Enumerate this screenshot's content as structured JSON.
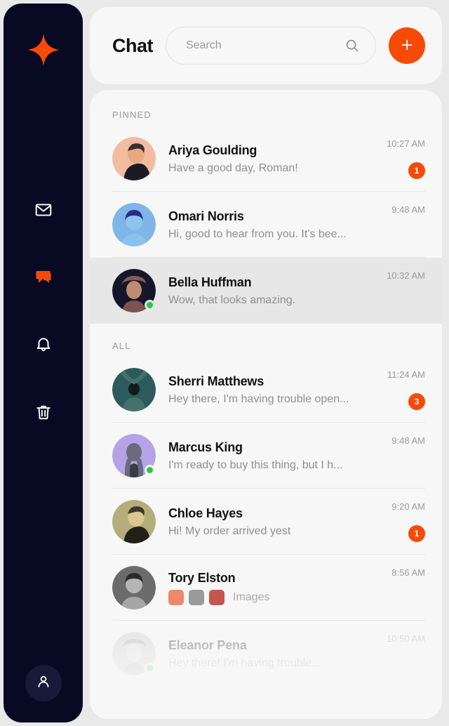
{
  "colors": {
    "accent": "#F74A07",
    "sidebar_bg": "#080A24",
    "card_bg": "#f7f7f7",
    "selected_bg": "#e7e7e7",
    "online": "#27C940",
    "page_bg": "#e9e9e9"
  },
  "sidebar": {
    "logo": "sparkle-logo",
    "items": [
      {
        "icon": "mail-icon",
        "name": "mail",
        "active": false
      },
      {
        "icon": "chat-icon",
        "name": "chat",
        "active": true
      },
      {
        "icon": "bell-icon",
        "name": "notifications",
        "active": false
      },
      {
        "icon": "trash-icon",
        "name": "trash",
        "active": false
      }
    ],
    "profile": {
      "icon": "user-icon",
      "name": "profile"
    }
  },
  "header": {
    "title": "Chat",
    "search": {
      "placeholder": "Search",
      "value": "",
      "icon": "search-icon"
    },
    "add_button": {
      "icon": "plus-icon",
      "label": "+"
    }
  },
  "list": {
    "sections": [
      {
        "label": "PINNED",
        "rows": [
          {
            "name": "Ariya Goulding",
            "preview": "Have a good day, Roman!",
            "time": "10:27 AM",
            "badge": "1",
            "online": false,
            "selected": false,
            "avatar": {
              "bg": "#F3BCA0",
              "fig": "#1b1b24",
              "skin": "#e8a882"
            }
          },
          {
            "name": "Omari Norris",
            "preview": "Hi, good to hear from you. It's bee...",
            "time": "9:48 AM",
            "badge": "",
            "online": false,
            "selected": false,
            "avatar": {
              "bg": "#7FB5E8",
              "fig": "#2C2C8C",
              "skin": "#8fc4ee"
            }
          },
          {
            "name": "Bella Huffman",
            "preview": "Wow,  that looks amazing.",
            "time": "10:32 AM",
            "badge": "",
            "online": true,
            "selected": true,
            "avatar": {
              "bg": "#14162b",
              "fig": "#8a5a52",
              "skin": "#c08a74"
            }
          }
        ]
      },
      {
        "label": "ALL",
        "rows": [
          {
            "name": "Sherri Matthews",
            "preview": "Hey there, I'm having trouble open...",
            "time": "11:24 AM",
            "badge": "3",
            "online": false,
            "selected": false,
            "avatar": {
              "bg": "#2D5A5A",
              "fig": "#101c1c",
              "skin": "#46706e"
            }
          },
          {
            "name": "Marcus King",
            "preview": "I'm ready to buy this thing, but I h...",
            "time": "9:48 AM",
            "badge": "",
            "online": true,
            "selected": false,
            "avatar": {
              "bg": "#B5A3E8",
              "fig": "#3a3a4a",
              "skin": "#6b6b7d"
            }
          },
          {
            "name": "Chloe Hayes",
            "preview": "Hi! My order arrived yest",
            "time": "9:20 AM",
            "badge": "1",
            "online": false,
            "selected": false,
            "avatar": {
              "bg": "#B5AD7A",
              "fig": "#23201a",
              "skin": "#d9c88f"
            }
          },
          {
            "name": "Tory Elston",
            "preview": "",
            "preview_label": "Images",
            "thumbs": [
              "#F0866B",
              "#9a9a9a",
              "#C4564E"
            ],
            "time": "8:56 AM",
            "badge": "",
            "online": false,
            "selected": false,
            "avatar": {
              "bg": "#6b6b6b",
              "fig": "#2a2a2a",
              "skin": "#b5b5b5"
            }
          },
          {
            "name": "Eleanor Pena",
            "preview": "Hey there! I'm having trouble...",
            "time": "10:50 AM",
            "badge": "",
            "online": true,
            "selected": false,
            "faded": true,
            "avatar": {
              "bg": "#c9c9c9",
              "fig": "#9a9a9a",
              "skin": "#dedede"
            }
          }
        ]
      }
    ]
  }
}
